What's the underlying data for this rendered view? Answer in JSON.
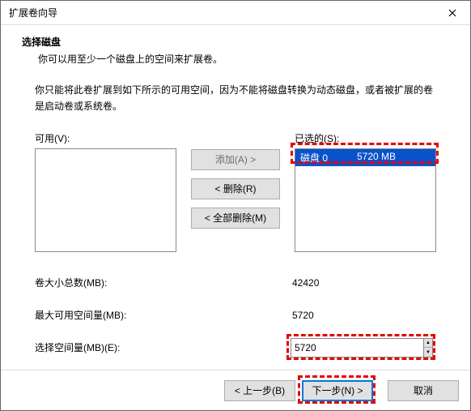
{
  "window": {
    "title": "扩展卷向导"
  },
  "header": {
    "heading": "选择磁盘",
    "subheading": "你可以用至少一个磁盘上的空间来扩展卷。"
  },
  "description": "你只能将此卷扩展到如下所示的可用空间，因为不能将磁盘转换为动态磁盘，或者被扩展的卷是启动卷或系统卷。",
  "lists": {
    "available_label": "可用(V):",
    "selected_label": "已选的(S):",
    "selected_items": [
      {
        "disk": "磁盘 0",
        "size": "5720 MB"
      }
    ]
  },
  "buttons": {
    "add": "添加(A) >",
    "remove": "< 删除(R)",
    "remove_all": "< 全部删除(M)",
    "back": "< 上一步(B)",
    "next": "下一步(N) >",
    "cancel": "取消"
  },
  "fields": {
    "total_label": "卷大小总数(MB):",
    "total_value": "42420",
    "max_label": "最大可用空间量(MB):",
    "max_value": "5720",
    "select_label": "选择空间量(MB)(E):",
    "select_value": "5720"
  }
}
